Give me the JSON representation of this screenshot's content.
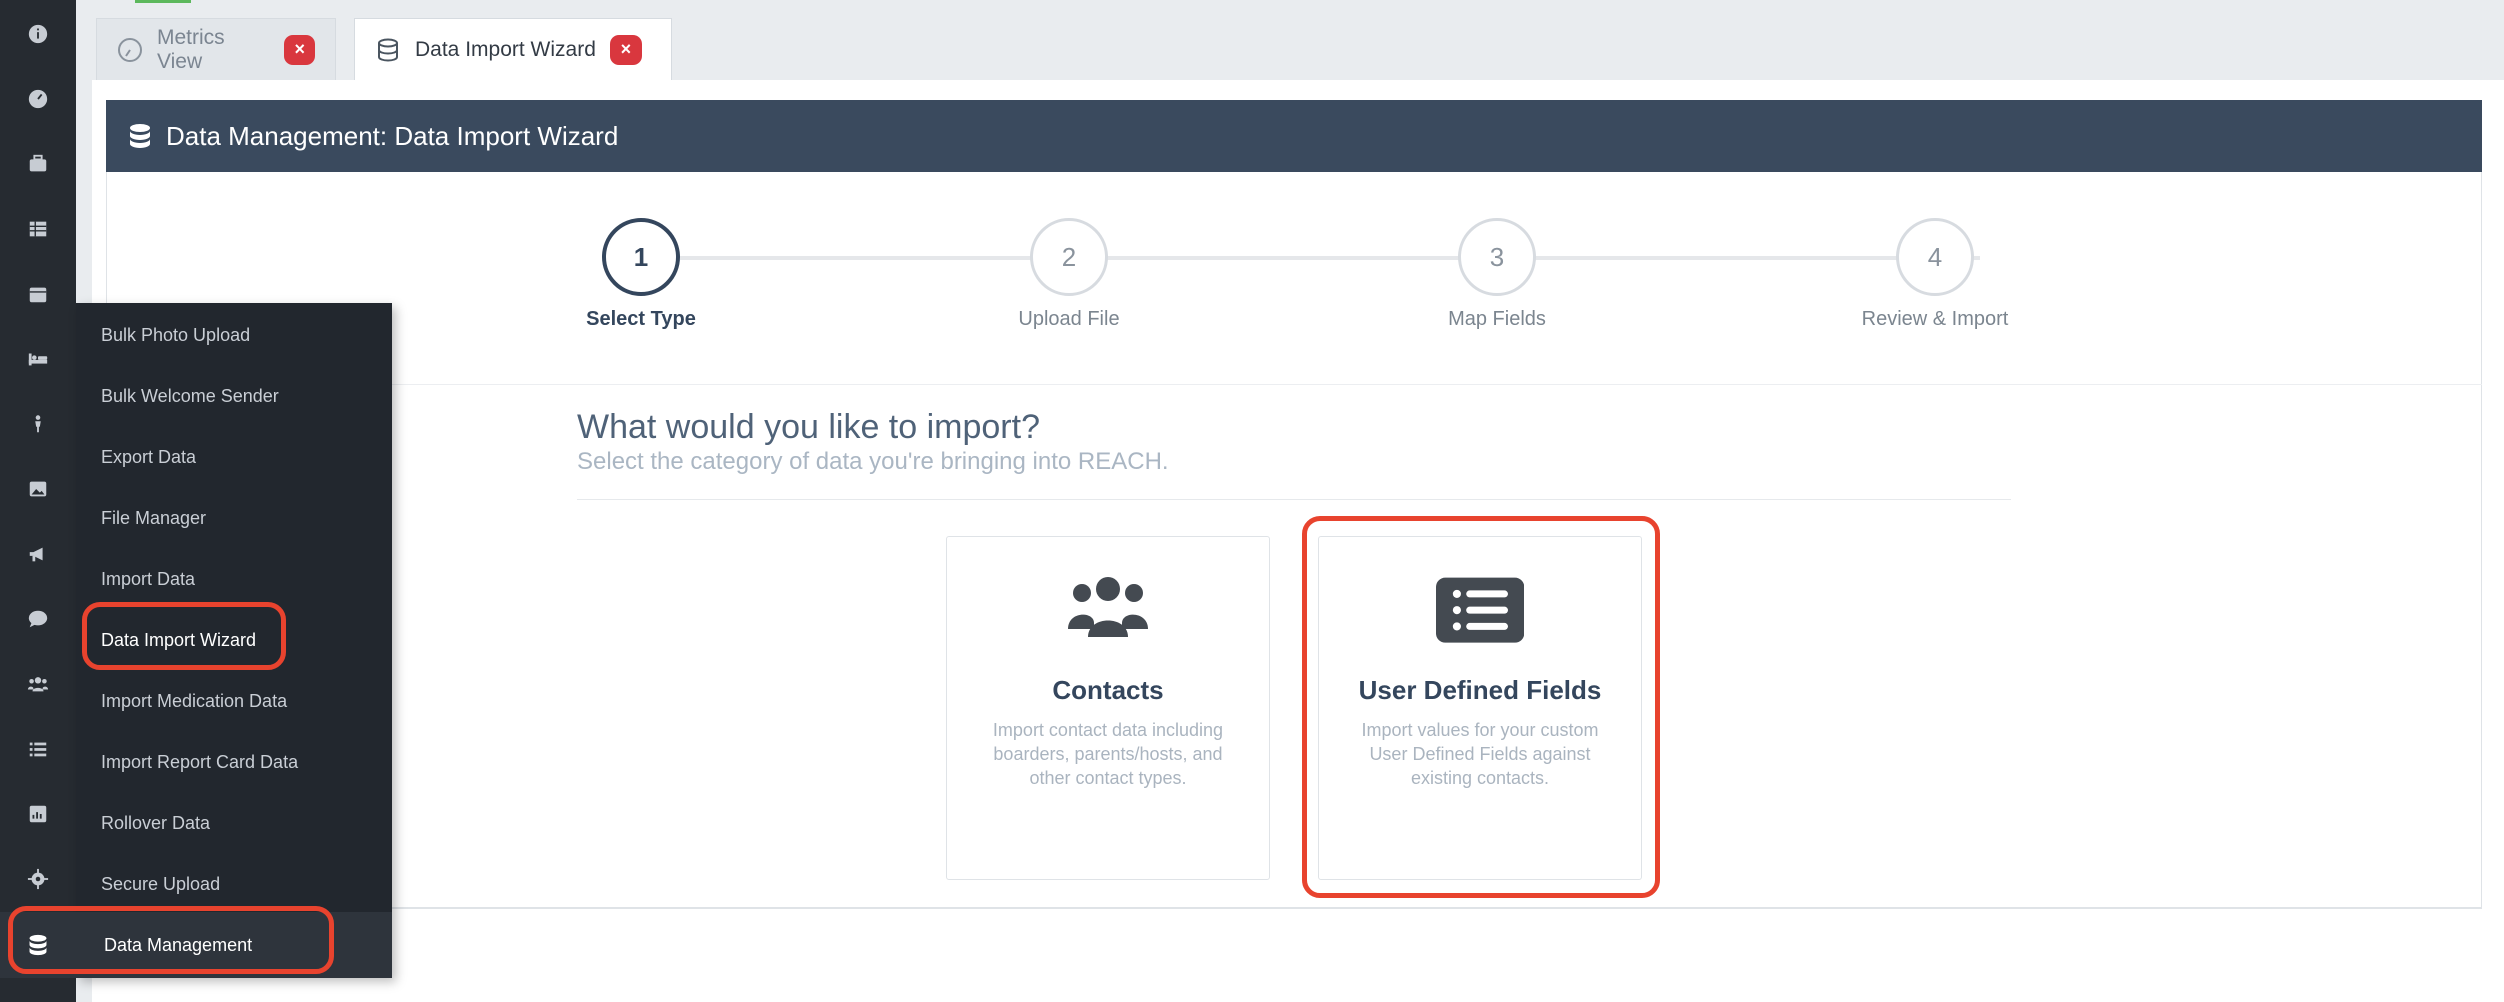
{
  "tabs": [
    {
      "label": "Metrics View",
      "icon": "gauge-icon",
      "close": "×"
    },
    {
      "label": "Data Import Wizard",
      "icon": "database-icon",
      "close": "×"
    }
  ],
  "header": {
    "title": "Data Management: Data Import Wizard",
    "icon": "database-icon"
  },
  "steps": [
    {
      "number": "1",
      "label": "Select Type"
    },
    {
      "number": "2",
      "label": "Upload File"
    },
    {
      "number": "3",
      "label": "Map Fields"
    },
    {
      "number": "4",
      "label": "Review & Import"
    }
  ],
  "prompt": {
    "question": "What would you like to import?",
    "subtitle": "Select the category of data you're bringing into REACH."
  },
  "options": [
    {
      "title": "Contacts",
      "description": "Import contact data including boarders, parents/hosts, and other contact types.",
      "icon": "users-icon"
    },
    {
      "title": "User Defined Fields",
      "description": "Import values for your custom User Defined Fields against existing contacts.",
      "icon": "list-icon"
    }
  ],
  "flyout": {
    "items": [
      "Bulk Photo Upload",
      "Bulk Welcome Sender",
      "Export Data",
      "File Manager",
      "Import Data",
      "Data Import Wizard",
      "Import Medication Data",
      "Import Report Card Data",
      "Rollover Data",
      "Secure Upload"
    ],
    "footer_label": "Data Management"
  },
  "rail_icons": [
    "info-icon",
    "dashboard-icon",
    "briefcase-icon",
    "table-icon",
    "calendar-icon",
    "bed-icon",
    "person-icon",
    "image-icon",
    "megaphone-icon",
    "chat-icon",
    "users-icon",
    "list-icon",
    "report-icon",
    "gear-icon"
  ],
  "colors": {
    "accent": "#34465d",
    "header_bg": "#3a4a5e",
    "highlight": "#e8432e",
    "close_badge": "#d9373e"
  }
}
